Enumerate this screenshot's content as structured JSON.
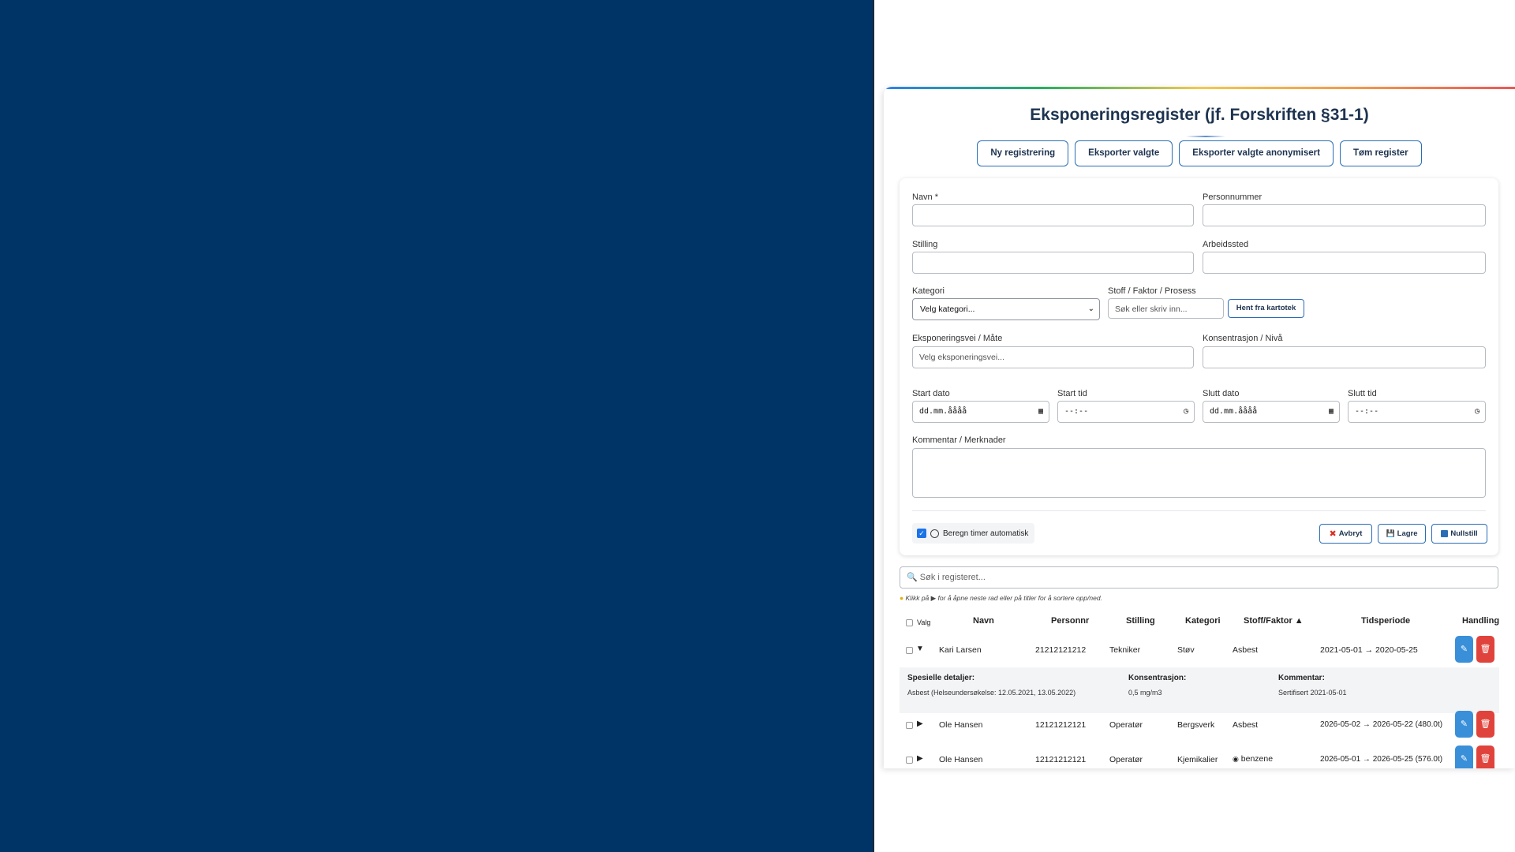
{
  "app": {
    "title": "Eksponeringsregister (jf. Forskriften §31-1)",
    "buttons": {
      "new": "Ny registrering",
      "export": "Eksporter valgte",
      "export_anon": "Eksporter valgte anonymisert",
      "clear": "Tøm register"
    }
  },
  "form": {
    "name_label": "Navn *",
    "ssn_label": "Personnummer",
    "position_label": "Stilling",
    "workplace_label": "Arbeidssted",
    "category_label": "Kategori",
    "category_value": "Velg kategori...",
    "substance_label": "Stoff / Faktor / Prosess",
    "substance_placeholder": "Søk eller skriv inn...",
    "fetch_button": "Hent fra kartotek",
    "route_label": "Eksponeringsvei / Måte",
    "route_placeholder": "Velg eksponeringsvei...",
    "concentration_label": "Konsentrasjon / Nivå",
    "start_date_label": "Start dato",
    "start_date_value": "dd.mm.åååå",
    "start_time_label": "Start tid",
    "start_time_value": "--:--",
    "end_date_label": "Slutt dato",
    "end_date_value": "dd.mm.åååå",
    "end_time_label": "Slutt tid",
    "end_time_value": "--:--",
    "comment_label": "Kommentar / Merknader",
    "auto_calc_label": "Beregn timer automatisk",
    "auto_calc_checked": true,
    "cancel": "Avbryt",
    "save": "Lagre",
    "reset": "Nullstill"
  },
  "search": {
    "placeholder": "Søk i registeret...",
    "hint": "Klikk på ▶ for å åpne neste rad eller på titler for å sortere opp/ned."
  },
  "table": {
    "headers": {
      "select": "Valg",
      "name": "Navn",
      "ssn": "Personnr",
      "position": "Stilling",
      "category": "Kategori",
      "substance": "Stoff/Faktor ▲",
      "period": "Tidsperiode",
      "actions": "Handling"
    },
    "rows": [
      {
        "expanded": true,
        "toggle": "▼",
        "name": "Kari Larsen",
        "ssn": "21212121212",
        "position": "Tekniker",
        "category": "Støv",
        "substance": "Asbest",
        "period": "2021-05-01 → 2020-05-25"
      },
      {
        "expanded": false,
        "toggle": "▶",
        "name": "Ole Hansen",
        "ssn": "12121212121",
        "position": "Operatør",
        "category": "Bergsverk",
        "substance": "Asbest",
        "period": "2026-05-02 → 2026-05-22 (480.0t)"
      },
      {
        "expanded": false,
        "toggle": "▶",
        "name": "Ole Hansen",
        "ssn": "12121212121",
        "position": "Operatør",
        "category": "Kjemikalier",
        "substance": "benzene",
        "period": "2026-05-01 → 2026-05-25 (576.0t)"
      }
    ],
    "detail": {
      "special_label": "Spesielle detaljer:",
      "special_value": "Asbest (Helseundersøkelse: 12.05.2021, 13.05.2022)",
      "concentration_label": "Konsentrasjon:",
      "concentration_value": "0,5 mg/m3",
      "comment_label": "Kommentar:",
      "comment_value": "Sertifisert 2021-05-01"
    }
  },
  "colors": {
    "left_panel": "#003366",
    "accent": "#2a6db5",
    "edit": "#3a8fd9",
    "delete": "#e0433b"
  }
}
